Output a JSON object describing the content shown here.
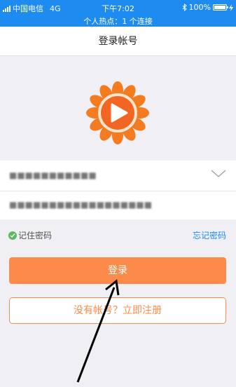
{
  "status_bar": {
    "carrier": "中国电信",
    "network": "4G",
    "time": "下午7:02",
    "battery": "100%",
    "battery_level": 1.0,
    "hotspot": "个人热点：1 个连接"
  },
  "nav": {
    "title": "登录帐号"
  },
  "form": {
    "account_value": "■■■■■■■■■■■",
    "password_value": "■■■■■■■■■■■■■■■■■■",
    "remember_label": "记住密码",
    "forgot_label": "忘记密码",
    "login_label": "登录",
    "register_label": "没有帐号？立即注册"
  },
  "colors": {
    "status_bar": "#1e8bf0",
    "accent": "#fb8a4b",
    "link": "#1e8bf0",
    "check": "#5cb85c",
    "background": "#efeff4"
  },
  "icons": {
    "logo": "sun-play-logo-icon",
    "dropdown": "chevron-down-icon",
    "remember": "check-circle-icon"
  }
}
